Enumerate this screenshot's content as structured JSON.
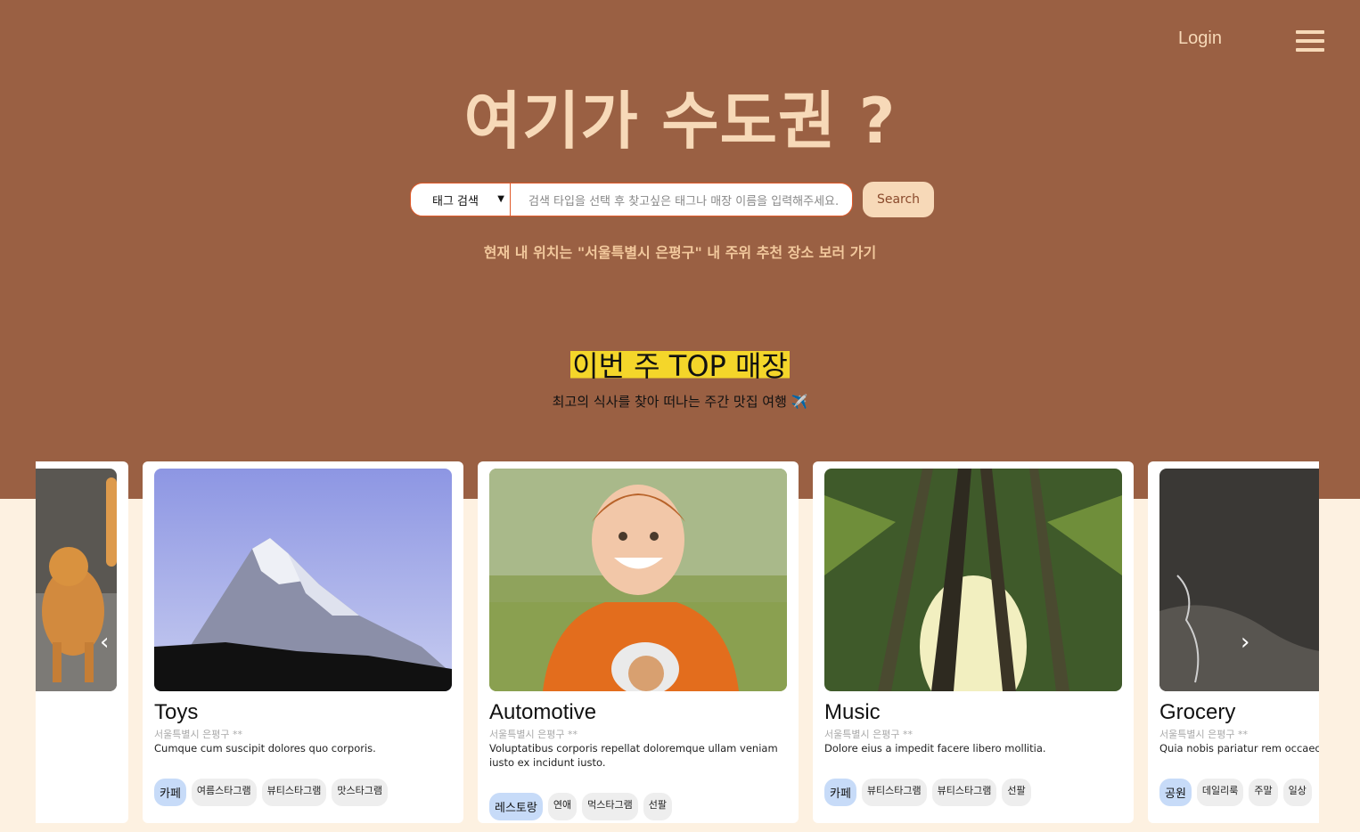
{
  "header": {
    "login_label": "Login",
    "menu_icon": "hamburger-menu-icon"
  },
  "hero": {
    "title": "여기가 수도권 ?",
    "search_type_value": "태그 검색",
    "search_placeholder": "검색 타입을 선택 후 찾고싶은 태그나 매장 이름을 입력해주세요.",
    "search_button": "Search",
    "location_text": "현재 내 위치는 \"서울특별시 은평구\"  내 주위 추천 장소 보러 가기"
  },
  "section": {
    "title": "이번 주 TOP 매장",
    "subtitle": "최고의 식사를 찾아 떠나는 주간 맛집 여행 ✈️"
  },
  "cards": [
    {
      "title": "",
      "location": "",
      "description": "",
      "tags": []
    },
    {
      "title": "Toys",
      "location": "서울특별시 은평구 **",
      "description": "Cumque cum suscipit dolores quo corporis.",
      "tags": [
        "카페",
        "여름스타그램",
        "뷰티스타그램",
        "맛스타그램"
      ]
    },
    {
      "title": "Automotive",
      "location": "서울특별시 은평구 **",
      "description": "Voluptatibus corporis repellat doloremque ullam veniam iusto ex incidunt iusto.",
      "tags": [
        "레스토랑",
        "연애",
        "먹스타그램",
        "선팔"
      ]
    },
    {
      "title": "Music",
      "location": "서울특별시 은평구 **",
      "description": "Dolore eius a impedit facere libero mollitia.",
      "tags": [
        "카페",
        "뷰티스타그램",
        "뷰티스타그램",
        "선팔"
      ]
    },
    {
      "title": "Grocery",
      "location": "서울특별시 은평구 **",
      "description": "Quia nobis pariatur rem occaecati.",
      "tags": [
        "공원",
        "데일리룩",
        "주말",
        "일상"
      ]
    }
  ],
  "carousel": {
    "prev_icon": "chevron-left-icon",
    "next_icon": "chevron-right-icon",
    "prev_glyph": "‹",
    "next_glyph": "›"
  },
  "colors": {
    "hero_bg": "#9a6043",
    "accent_text": "#f7d9b8",
    "highlight": "#f4d62a",
    "page_bg": "#fdf1e1",
    "input_border": "#e05a2a"
  }
}
